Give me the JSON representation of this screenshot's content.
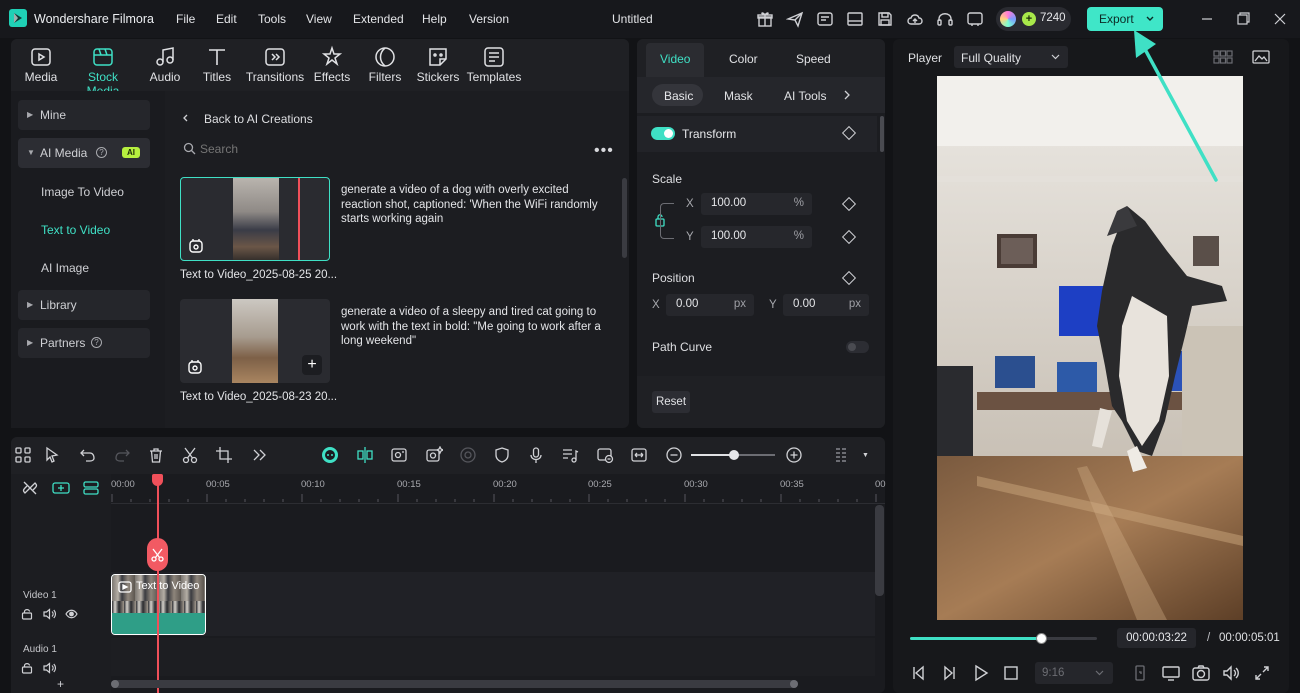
{
  "app": {
    "name": "Wondershare Filmora",
    "project_title": "Untitled"
  },
  "menu": [
    "File",
    "Edit",
    "Tools",
    "View",
    "Extended",
    "Help",
    "Version"
  ],
  "credits": "7240",
  "export_label": "Export",
  "media_tabs": [
    {
      "label": "Media",
      "icon": "media-icon"
    },
    {
      "label": "Stock Media",
      "icon": "stock-media-icon"
    },
    {
      "label": "Audio",
      "icon": "audio-icon"
    },
    {
      "label": "Titles",
      "icon": "titles-icon"
    },
    {
      "label": "Transitions",
      "icon": "transitions-icon"
    },
    {
      "label": "Effects",
      "icon": "effects-icon"
    },
    {
      "label": "Filters",
      "icon": "filters-icon"
    },
    {
      "label": "Stickers",
      "icon": "stickers-icon"
    },
    {
      "label": "Templates",
      "icon": "templates-icon"
    }
  ],
  "sidebar": {
    "mine": "Mine",
    "ai_media": "AI Media",
    "ai_badge": "AI",
    "image_to_video": "Image To Video",
    "text_to_video": "Text to Video",
    "ai_image": "AI Image",
    "library": "Library",
    "partners": "Partners"
  },
  "browser": {
    "back": "Back to AI Creations",
    "search_placeholder": "Search",
    "items": [
      {
        "caption": "Text to Video_2025-08-25 20...",
        "prompt": "generate a video of a dog with overly excited reaction shot, captioned: 'When the WiFi randomly starts working again"
      },
      {
        "caption": "Text to Video_2025-08-23 20...",
        "prompt": "generate a video of a sleepy and tired cat going to work with the text in bold: \"Me going to work after a long weekend\""
      }
    ]
  },
  "properties": {
    "tabs": [
      "Video",
      "Color",
      "Speed"
    ],
    "subtabs": [
      "Basic",
      "Mask",
      "AI Tools"
    ],
    "transform": "Transform",
    "scale": "Scale",
    "scale_x": "100.00",
    "scale_y": "100.00",
    "percent": "%",
    "position": "Position",
    "pos_x": "0.00",
    "pos_y": "0.00",
    "px": "px",
    "x": "X",
    "y": "Y",
    "path_curve": "Path Curve",
    "reset": "Reset"
  },
  "player": {
    "label": "Player",
    "quality": "Full Quality",
    "current_time": "00:00:03:22",
    "separator": "/",
    "total_time": "00:00:05:01",
    "aspect": "9:16",
    "progress": 0.7
  },
  "timeline": {
    "ruler": [
      "00:00",
      "00:05",
      "00:10",
      "00:15",
      "00:20",
      "00:25",
      "00:30",
      "00:35",
      "00"
    ],
    "video_track": "Video 1",
    "audio_track": "Audio 1",
    "clip_label": "Text to Video",
    "add": "+"
  },
  "colors": {
    "accent": "#3fe0c5",
    "playhead": "#f0505a",
    "export_bg": "#3fe6c8"
  }
}
